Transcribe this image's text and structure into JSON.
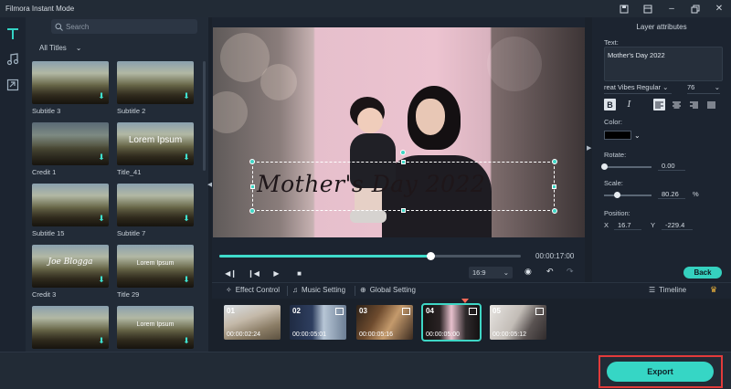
{
  "app": {
    "title": "Filmora Instant Mode"
  },
  "window": {
    "icons": [
      "save-icon",
      "screen-icon",
      "minimize-icon",
      "restore-icon",
      "close-icon"
    ]
  },
  "rail": {
    "items": [
      "titles-icon",
      "music-icon",
      "import-icon"
    ]
  },
  "library": {
    "search_placeholder": "Search",
    "filter_label": "All Titles",
    "items": [
      {
        "label": "Subtitle 3",
        "overlay": ""
      },
      {
        "label": "Subtitle 2",
        "overlay": ""
      },
      {
        "label": "Credit 1",
        "overlay": ""
      },
      {
        "label": "Title_41",
        "overlay": "Lorem Ipsum"
      },
      {
        "label": "Subtitle 15",
        "overlay": ""
      },
      {
        "label": "Subtitle 7",
        "overlay": ""
      },
      {
        "label": "Credit 3",
        "overlay": "Joe Blogga"
      },
      {
        "label": "Title 29",
        "overlay": "Lorem Ipsum"
      },
      {
        "label": "",
        "overlay": ""
      },
      {
        "label": "",
        "overlay": "Lorem Ipsum"
      }
    ]
  },
  "preview": {
    "overlay_text": "Mother's Day 2022",
    "progress_fraction": 0.7,
    "timecode": "00:00:17:00",
    "aspect_ratio": "16:9"
  },
  "attributes": {
    "heading": "Layer attributes",
    "text_label": "Text:",
    "text_value": "Mother's Day 2022",
    "font": "reat Vibes Regular",
    "font_size": "76",
    "color_label": "Color:",
    "color_value": "#000000",
    "rotate_label": "Rotate:",
    "rotate_value": "0.00",
    "scale_label": "Scale:",
    "scale_value": "80.26",
    "scale_unit": "%",
    "position_label": "Position:",
    "x_label": "X",
    "x_value": "16.7",
    "y_label": "Y",
    "y_value": "-229.4",
    "back_label": "Back"
  },
  "tabs": {
    "effect_control": "Effect Control",
    "music_setting": "Music Setting",
    "global_setting": "Global Setting",
    "timeline": "Timeline"
  },
  "clips": [
    {
      "num": "01",
      "time": "00:00:02:24"
    },
    {
      "num": "02",
      "time": "00:00:05:01"
    },
    {
      "num": "03",
      "time": "00:00:05:16"
    },
    {
      "num": "04",
      "time": "00:00:05:00"
    },
    {
      "num": "05",
      "time": "00:00:05:12"
    }
  ],
  "export": {
    "label": "Export"
  },
  "colors": {
    "accent": "#36d6c5",
    "highlight": "#e23b3b"
  }
}
